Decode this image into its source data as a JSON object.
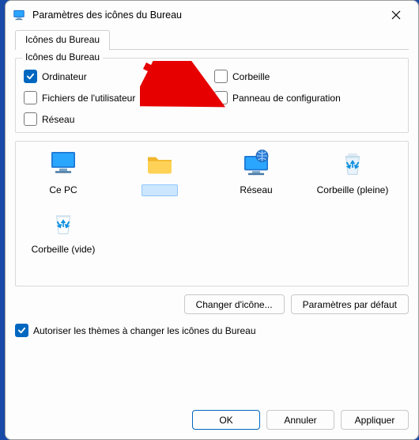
{
  "window": {
    "title": "Paramètres des icônes du Bureau"
  },
  "tabs": [
    {
      "label": "Icônes du Bureau"
    }
  ],
  "group": {
    "legend": "Icônes du Bureau",
    "items": {
      "computer": {
        "label": "Ordinateur",
        "checked": true
      },
      "recycle": {
        "label": "Corbeille",
        "checked": false
      },
      "userfiles": {
        "label": "Fichiers de l'utilisateur",
        "checked": false
      },
      "controlpanel": {
        "label": "Panneau de configuration",
        "checked": false
      },
      "network": {
        "label": "Réseau",
        "checked": false
      }
    }
  },
  "previews": {
    "thispc": {
      "caption": "Ce PC"
    },
    "userfolder": {
      "caption": ""
    },
    "network": {
      "caption": "Réseau"
    },
    "recycle_full": {
      "caption": "Corbeille (pleine)"
    },
    "recycle_empty": {
      "caption": "Corbeille (vide)"
    }
  },
  "buttons": {
    "change_icon": "Changer d'icône...",
    "restore_default": "Paramètres par défaut",
    "ok": "OK",
    "cancel": "Annuler",
    "apply": "Appliquer"
  },
  "allow_themes": {
    "label": "Autoriser les thèmes à changer les icônes du Bureau",
    "checked": true
  },
  "colors": {
    "accent": "#0067c0"
  }
}
